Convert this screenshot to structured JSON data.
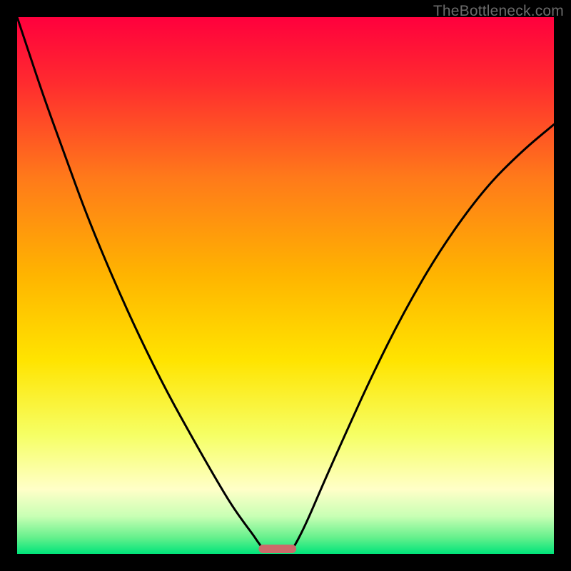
{
  "watermark": "TheBottleneck.com",
  "chart_data": {
    "type": "line",
    "title": "",
    "xlabel": "",
    "ylabel": "",
    "xlim": [
      0,
      100
    ],
    "ylim": [
      0,
      100
    ],
    "background_gradient": {
      "stops": [
        {
          "offset": 0.0,
          "color": "#ff003d"
        },
        {
          "offset": 0.12,
          "color": "#ff2a2f"
        },
        {
          "offset": 0.3,
          "color": "#ff7a1a"
        },
        {
          "offset": 0.48,
          "color": "#ffb400"
        },
        {
          "offset": 0.64,
          "color": "#ffe400"
        },
        {
          "offset": 0.78,
          "color": "#f6ff66"
        },
        {
          "offset": 0.88,
          "color": "#ffffc8"
        },
        {
          "offset": 0.93,
          "color": "#c8ffb4"
        },
        {
          "offset": 0.97,
          "color": "#64f08c"
        },
        {
          "offset": 1.0,
          "color": "#00e47a"
        }
      ]
    },
    "series": [
      {
        "name": "left-curve",
        "x": [
          0.0,
          2.0,
          5.0,
          9.0,
          13.0,
          18.0,
          23.0,
          28.0,
          33.0,
          37.0,
          40.0,
          42.5,
          44.0,
          45.0,
          45.8,
          46.2
        ],
        "y": [
          100.0,
          94.0,
          85.0,
          74.0,
          63.0,
          51.0,
          40.0,
          30.0,
          21.0,
          14.0,
          9.0,
          5.5,
          3.5,
          2.0,
          1.0,
          0.5
        ]
      },
      {
        "name": "right-curve",
        "x": [
          51.0,
          52.0,
          54.0,
          57.0,
          61.0,
          66.0,
          72.0,
          79.0,
          87.0,
          94.0,
          100.0
        ],
        "y": [
          0.5,
          2.0,
          6.0,
          13.0,
          22.0,
          33.0,
          45.0,
          57.0,
          68.0,
          75.0,
          80.0
        ]
      }
    ],
    "marker": {
      "name": "bottleneck-marker",
      "x_center": 48.5,
      "width": 7.0,
      "height_pct": 1.6,
      "fill": "#cc6a6a"
    }
  }
}
